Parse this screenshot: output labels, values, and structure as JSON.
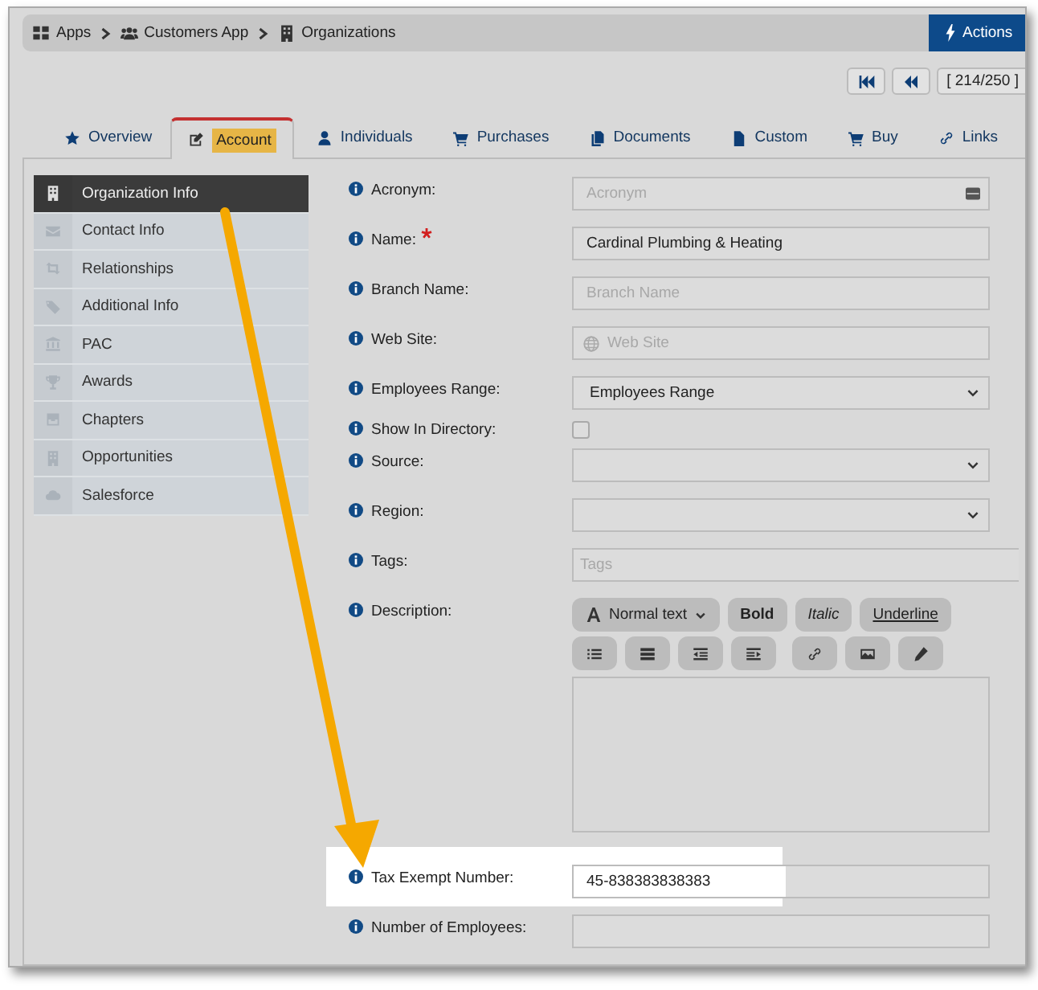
{
  "breadcrumb": [
    {
      "label": "Apps"
    },
    {
      "label": "Customers App"
    },
    {
      "label": "Organizations"
    }
  ],
  "actions_button": "Actions",
  "pager": {
    "record": "[ 214/250 ]"
  },
  "tabs": [
    {
      "label": "Overview",
      "selected": false,
      "highlighted": false
    },
    {
      "label": "Account",
      "selected": true,
      "highlighted": true
    },
    {
      "label": "Individuals",
      "selected": false,
      "highlighted": false
    },
    {
      "label": "Purchases",
      "selected": false,
      "highlighted": false
    },
    {
      "label": "Documents",
      "selected": false,
      "highlighted": false
    },
    {
      "label": "Custom",
      "selected": false,
      "highlighted": false
    },
    {
      "label": "Buy",
      "selected": false,
      "highlighted": false
    },
    {
      "label": "Links",
      "selected": false,
      "highlighted": false
    }
  ],
  "sidebar": {
    "items": [
      {
        "label": "Organization Info",
        "selected": true
      },
      {
        "label": "Contact Info",
        "selected": false
      },
      {
        "label": "Relationships",
        "selected": false
      },
      {
        "label": "Additional Info",
        "selected": false
      },
      {
        "label": "PAC",
        "selected": false
      },
      {
        "label": "Awards",
        "selected": false
      },
      {
        "label": "Chapters",
        "selected": false
      },
      {
        "label": "Opportunities",
        "selected": false
      },
      {
        "label": "Salesforce",
        "selected": false
      }
    ]
  },
  "form": {
    "fields": [
      {
        "kind": "text",
        "label": "Acronym:",
        "placeholder": "Acronym"
      },
      {
        "kind": "text",
        "label": "Name:",
        "value": "Cardinal Plumbing & Heating",
        "required": true
      },
      {
        "kind": "text",
        "label": "Branch Name:",
        "placeholder": "Branch Name"
      },
      {
        "kind": "url",
        "label": "Web Site:",
        "placeholder": "Web Site"
      },
      {
        "kind": "select",
        "label": "Employees Range:",
        "value": "Employees Range"
      },
      {
        "kind": "checkbox",
        "label": "Show In Directory:",
        "checked": false
      },
      {
        "kind": "select",
        "label": "Source:"
      },
      {
        "kind": "select",
        "label": "Region:"
      },
      {
        "kind": "tags",
        "label": "Tags:",
        "placeholder": "Tags"
      },
      {
        "kind": "editor",
        "label": "Description:",
        "format": "Normal text",
        "buttons": [
          "Bold",
          "Italic",
          "Underline"
        ]
      },
      {
        "kind": "text",
        "label": "Tax Exempt Number:",
        "value": "45-838383838383",
        "highlighted": true
      },
      {
        "kind": "text",
        "label": "Number of Employees:"
      }
    ]
  }
}
